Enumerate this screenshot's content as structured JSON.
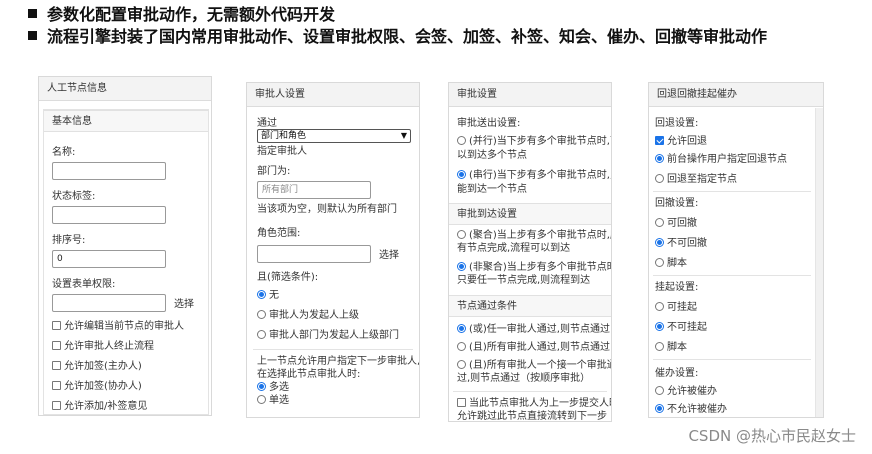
{
  "bullets": [
    "参数化配置审批动作，无需额外代码开发",
    "流程引擎封装了国内常用审批动作、设置审批权限、会签、加签、补签、知会、催办、回撤等审批动作"
  ],
  "panel1": {
    "header": "人工节点信息",
    "section": "基本信息",
    "name_label": "名称:",
    "status_label": "状态标签:",
    "order_label": "排序号:",
    "order_value": "0",
    "form_perm_label": "设置表单权限:",
    "select_link": "选择",
    "checks": [
      {
        "label": "允许编辑当前节点的审批人",
        "checked": false
      },
      {
        "label": "允许审批人终止流程",
        "checked": false
      },
      {
        "label": "允许加签(主办人)",
        "checked": false
      },
      {
        "label": "允许加签(协办人)",
        "checked": false
      },
      {
        "label": "允许添加/补签意见",
        "checked": false
      }
    ]
  },
  "panel2": {
    "header": "审批人设置",
    "via_label": "通过",
    "via_select": "部门和角色",
    "assign_label": "指定审批人",
    "dept_label": "部门为:",
    "dept_placeholder": "所有部门",
    "dept_hint": "当该项为空，则默认为所有部门",
    "role_label": "角色范围:",
    "select_link": "选择",
    "filter_label": "且(筛选条件):",
    "filter_options": [
      {
        "label": "无",
        "checked": true
      },
      {
        "label": "审批人为发起人上级",
        "checked": false
      },
      {
        "label": "审批人部门为发起人上级部门",
        "checked": false
      }
    ],
    "prev_label_1": "上一节点允许用户指定下一步审批人,",
    "prev_label_2": "在选择此节点审批人时:",
    "select_options": [
      {
        "label": "多选",
        "checked": true
      },
      {
        "label": "单选",
        "checked": false
      }
    ]
  },
  "panel3": {
    "header": "审批设置",
    "send_label": "审批送出设置:",
    "send_options": [
      {
        "line1": "(并行)当下步有多个审批节点时,可",
        "line2": "以到达多个节点",
        "checked": false
      },
      {
        "line1": "(串行)当下步有多个审批节点时,只",
        "line2": "能到达一个节点",
        "checked": true
      }
    ],
    "arrive_header": "审批到达设置",
    "arrive_options": [
      {
        "line1": "(聚合)当上步有多个审批节点时,所",
        "line2": "有节点完成,流程可以到达",
        "checked": false
      },
      {
        "line1": "(非聚合)当上步有多个审批节点时,",
        "line2": "只要任一节点完成,则流程到达",
        "checked": true
      }
    ],
    "pass_header": "节点通过条件",
    "pass_options": [
      {
        "line1": "(或)任一审批人通过,则节点通过",
        "line2": "",
        "checked": true
      },
      {
        "line1": "(且)所有审批人通过,则节点通过",
        "line2": "",
        "checked": false
      },
      {
        "line1": "(且)所有审批人一个接一个审批通",
        "line2": "过,则节点通过（按顺序审批）",
        "checked": false
      }
    ],
    "skip_line1": "当此节点审批人为上一步提交人时,",
    "skip_line2": "允许跳过此节点直接流转到下一步"
  },
  "panel4": {
    "header": "回退回撤挂起催办",
    "back_label": "回退设置:",
    "back_options": [
      {
        "label": "允许回退",
        "type": "check",
        "checked": true
      },
      {
        "label": "前台操作用户指定回退节点",
        "type": "radio",
        "checked": true
      },
      {
        "label": "回退至指定节点",
        "type": "radio",
        "checked": false
      }
    ],
    "recall_label": "回撤设置:",
    "recall_options": [
      {
        "label": "可回撤",
        "checked": false
      },
      {
        "label": "不可回撤",
        "checked": true
      },
      {
        "label": "脚本",
        "checked": false
      }
    ],
    "hang_label": "挂起设置:",
    "hang_options": [
      {
        "label": "可挂起",
        "checked": false
      },
      {
        "label": "不可挂起",
        "checked": true
      },
      {
        "label": "脚本",
        "checked": false
      }
    ],
    "urge_label": "催办设置:",
    "urge_options": [
      {
        "label": "允许被催办",
        "checked": false
      },
      {
        "label": "不允许被催办",
        "checked": true
      }
    ]
  },
  "watermark": "CSDN @热心市民赵女士"
}
